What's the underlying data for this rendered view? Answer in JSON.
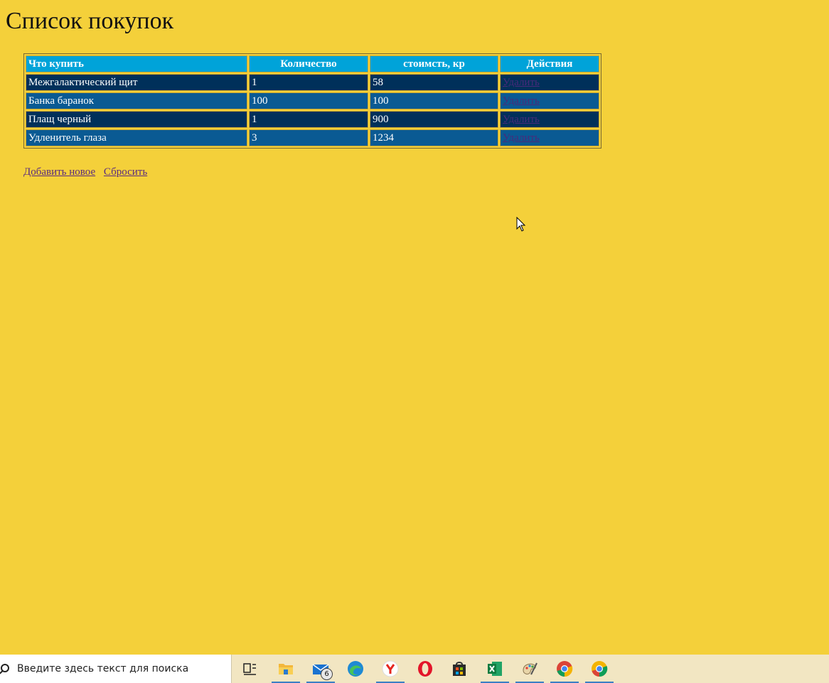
{
  "page": {
    "title": "Список покупок"
  },
  "table": {
    "headers": [
      "Что купить",
      "Количество",
      "стоимсть, кр",
      "Действия"
    ],
    "rows": [
      {
        "item": "Межгалактический щит",
        "qty": "1",
        "cost": "58",
        "action": "Удалить"
      },
      {
        "item": "Банка баранок",
        "qty": "100",
        "cost": "100",
        "action": "Удалить"
      },
      {
        "item": "Плащ черный",
        "qty": "1",
        "cost": "900",
        "action": "Удалить"
      },
      {
        "item": "Удленитель глаза",
        "qty": "3",
        "cost": "1234",
        "action": "Удалить"
      }
    ]
  },
  "links": {
    "add_new": "Добавить новое",
    "reset": "Сбросить"
  },
  "taskbar": {
    "search_placeholder": "Введите здесь текст для поиска",
    "mail_badge": "6",
    "icons": [
      "task-view-icon",
      "file-explorer-icon",
      "mail-icon",
      "edge-icon",
      "yandex-browser-icon",
      "opera-icon",
      "store-icon",
      "excel-icon",
      "paint-icon",
      "chrome-icon",
      "chrome-canary-icon"
    ]
  },
  "colors": {
    "background": "#f4d03a",
    "header_cell": "#00a3d9",
    "row_dark": "#00305a",
    "row_light": "#0a5a93"
  }
}
